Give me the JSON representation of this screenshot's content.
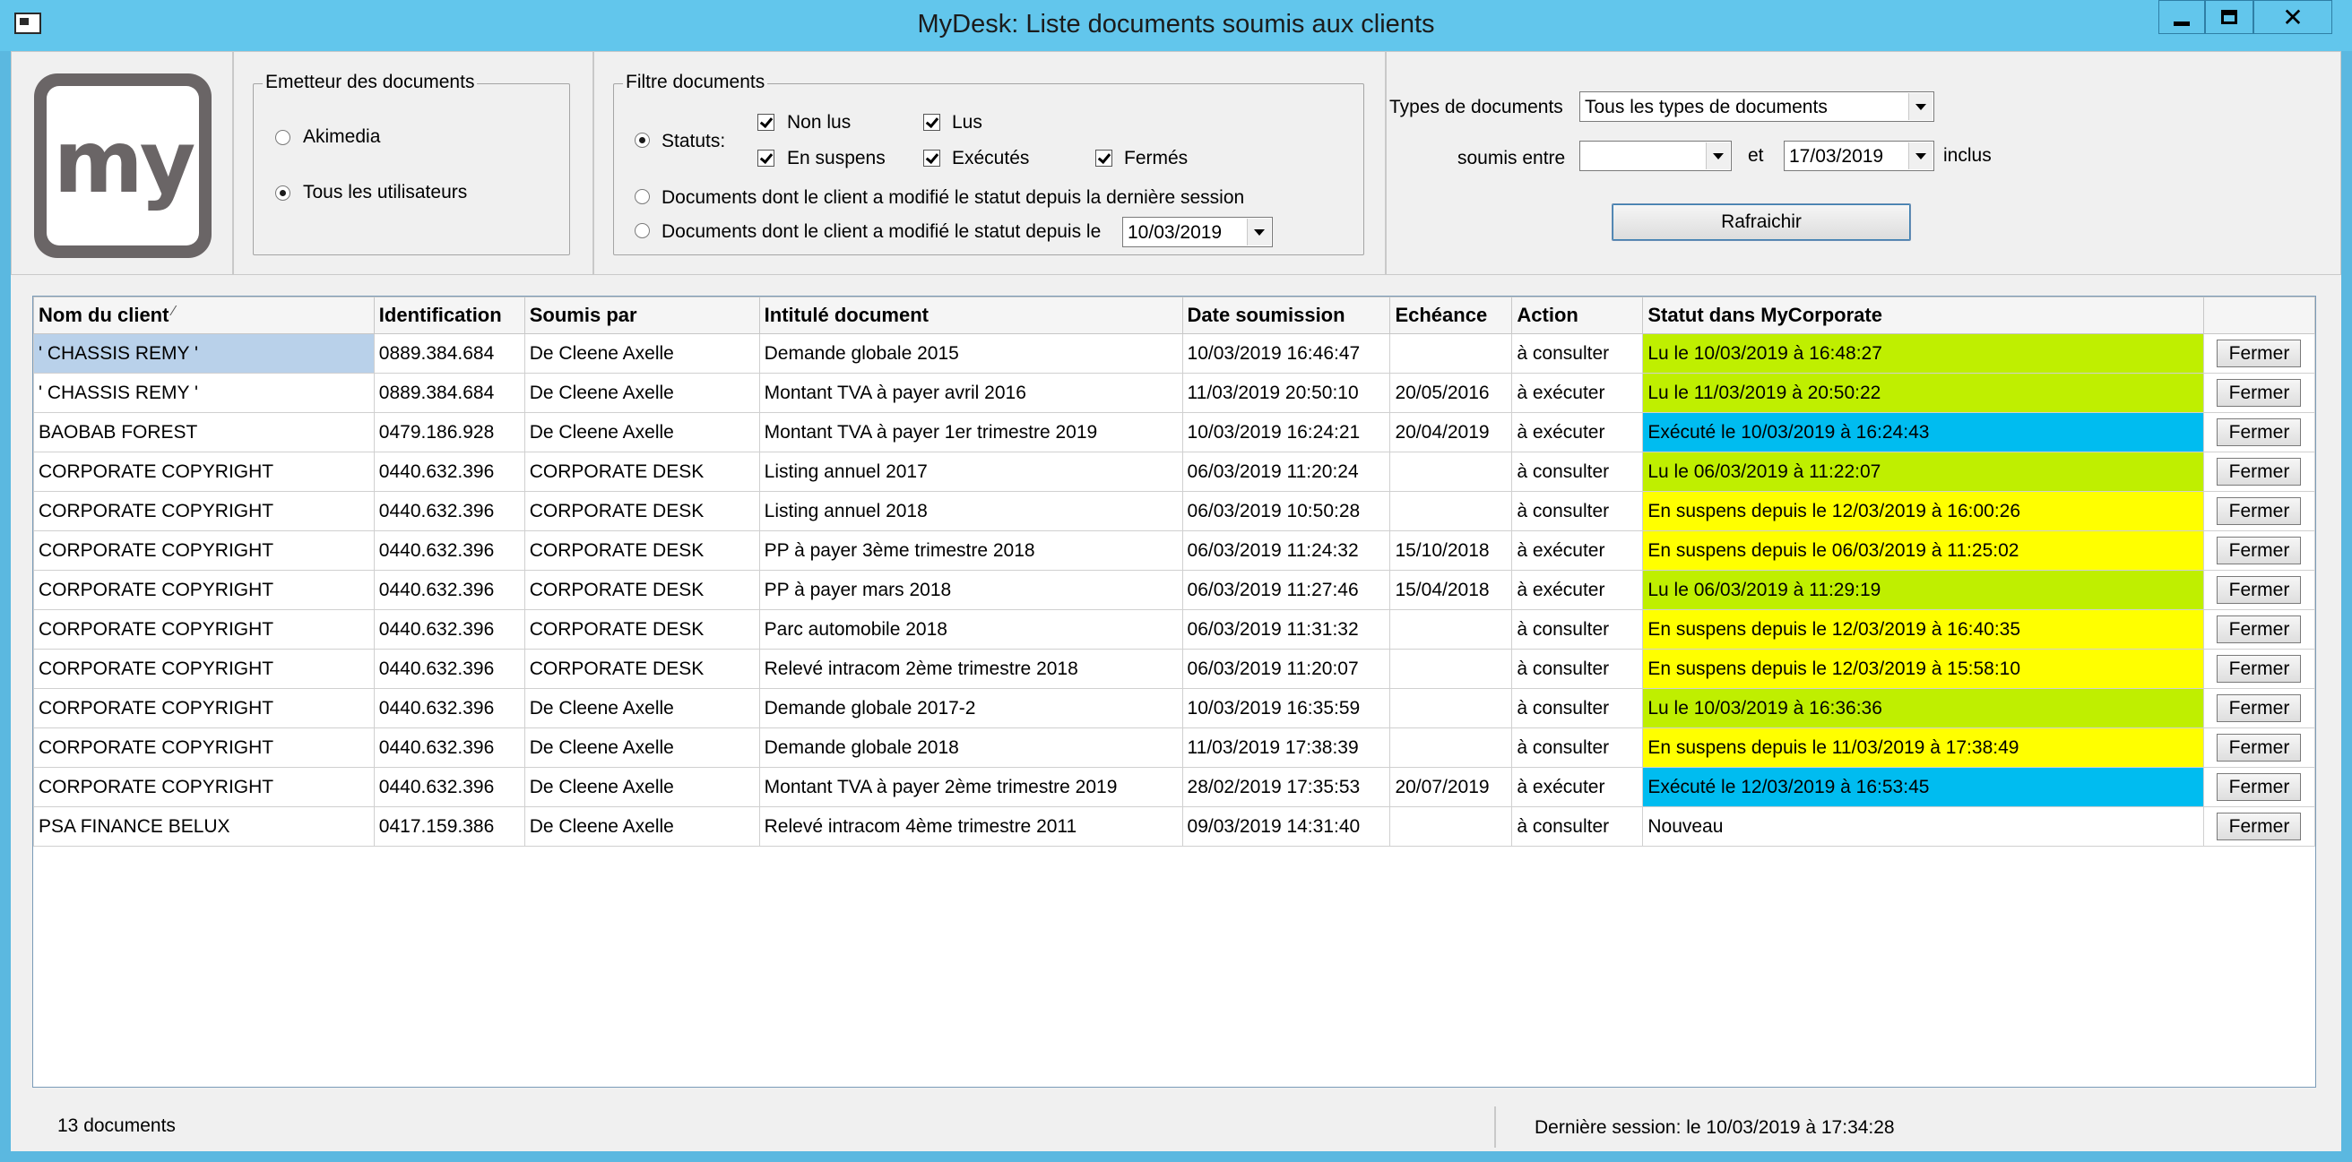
{
  "window": {
    "title": "MyDesk: Liste documents soumis aux clients",
    "minimize": "minimize-icon",
    "maximize": "maximize-icon",
    "close": "✕"
  },
  "logo": {
    "text": "my"
  },
  "emetteur": {
    "legend": "Emetteur des documents",
    "options": [
      {
        "label": "Akimedia",
        "selected": false
      },
      {
        "label": "Tous les utilisateurs",
        "selected": true
      }
    ]
  },
  "filtre": {
    "legend": "Filtre documents",
    "statuts_label": "Statuts:",
    "checks": {
      "non_lus": "Non lus",
      "lus": "Lus",
      "en_suspens": "En suspens",
      "executes": "Exécutés",
      "fermes": "Fermés"
    },
    "option_session": "Documents dont le client a modifié le statut depuis la dernière session",
    "option_depuis": "Documents dont le client a modifié le statut depuis le",
    "depuis_date": "10/03/2019"
  },
  "types": {
    "label": "Types de documents",
    "value": "Tous les types de documents",
    "soumis_entre": "soumis entre",
    "date_from": "",
    "et": "et",
    "date_to": "17/03/2019",
    "inclus": "inclus",
    "refresh": "Rafraichir"
  },
  "grid": {
    "headers": [
      "Nom du client",
      "Identification",
      "Soumis par",
      "Intitulé document",
      "Date soumission",
      "Echéance",
      "Action",
      "Statut dans MyCorporate",
      ""
    ],
    "sort_glyph": "⁄",
    "button_label": "Fermer",
    "rows": [
      [
        "' CHASSIS REMY '",
        "0889.384.684",
        "De Cleene Axelle",
        "Demande globale 2015",
        "10/03/2019 16:46:47",
        "",
        "à consulter",
        "Lu le 10/03/2019 à 16:48:27",
        "lu"
      ],
      [
        "' CHASSIS REMY '",
        "0889.384.684",
        "De Cleene Axelle",
        "Montant TVA à payer avril 2016",
        "11/03/2019 20:50:10",
        "20/05/2016",
        "à exécuter",
        "Lu le 11/03/2019 à 20:50:22",
        "lu"
      ],
      [
        "BAOBAB FOREST",
        "0479.186.928",
        "De Cleene Axelle",
        "Montant TVA à payer 1er trimestre 2019",
        "10/03/2019 16:24:21",
        "20/04/2019",
        "à exécuter",
        "Exécuté le 10/03/2019 à 16:24:43",
        "execute"
      ],
      [
        "CORPORATE COPYRIGHT",
        "0440.632.396",
        "CORPORATE DESK",
        "Listing annuel 2017",
        "06/03/2019 11:20:24",
        "",
        "à consulter",
        "Lu le 06/03/2019 à 11:22:07",
        "lu"
      ],
      [
        "CORPORATE COPYRIGHT",
        "0440.632.396",
        "CORPORATE DESK",
        "Listing annuel 2018",
        "06/03/2019 10:50:28",
        "",
        "à consulter",
        "En suspens depuis le 12/03/2019 à 16:00:26",
        "suspens"
      ],
      [
        "CORPORATE COPYRIGHT",
        "0440.632.396",
        "CORPORATE DESK",
        "PP à payer 3ème trimestre 2018",
        "06/03/2019 11:24:32",
        "15/10/2018",
        "à exécuter",
        "En suspens depuis le 06/03/2019 à 11:25:02",
        "suspens"
      ],
      [
        "CORPORATE COPYRIGHT",
        "0440.632.396",
        "CORPORATE DESK",
        "PP à payer mars 2018",
        "06/03/2019 11:27:46",
        "15/04/2018",
        "à exécuter",
        "Lu le 06/03/2019 à 11:29:19",
        "lu"
      ],
      [
        "CORPORATE COPYRIGHT",
        "0440.632.396",
        "CORPORATE DESK",
        "Parc automobile 2018",
        "06/03/2019 11:31:32",
        "",
        "à consulter",
        "En suspens depuis le 12/03/2019 à 16:40:35",
        "suspens"
      ],
      [
        "CORPORATE COPYRIGHT",
        "0440.632.396",
        "CORPORATE DESK",
        "Relevé intracom 2ème trimestre 2018",
        "06/03/2019 11:20:07",
        "",
        "à consulter",
        "En suspens depuis le 12/03/2019 à 15:58:10",
        "suspens"
      ],
      [
        "CORPORATE COPYRIGHT",
        "0440.632.396",
        "De Cleene Axelle",
        "Demande globale 2017-2",
        "10/03/2019 16:35:59",
        "",
        "à consulter",
        "Lu le 10/03/2019 à 16:36:36",
        "lu"
      ],
      [
        "CORPORATE COPYRIGHT",
        "0440.632.396",
        "De Cleene Axelle",
        "Demande globale 2018",
        "11/03/2019 17:38:39",
        "",
        "à consulter",
        "En suspens depuis le 11/03/2019 à 17:38:49",
        "suspens"
      ],
      [
        "CORPORATE COPYRIGHT",
        "0440.632.396",
        "De Cleene Axelle",
        "Montant TVA à payer 2ème trimestre 2019",
        "28/02/2019 17:35:53",
        "20/07/2019",
        "à exécuter",
        "Exécuté le 12/03/2019 à 16:53:45",
        "execute"
      ],
      [
        "PSA FINANCE BELUX",
        "0417.159.386",
        "De Cleene Axelle",
        "Relevé intracom 4ème trimestre 2011",
        "09/03/2019 14:31:40",
        "",
        "à consulter",
        "Nouveau",
        "nouveau"
      ]
    ]
  },
  "status_colors": {
    "lu": "#bfef00",
    "execute": "#00bcf0",
    "suspens": "#ffff00",
    "nouveau": "#ffffff"
  },
  "statusbar": {
    "count": "13 documents",
    "session": "Dernière session:  le 10/03/2019 à 17:34:28"
  }
}
